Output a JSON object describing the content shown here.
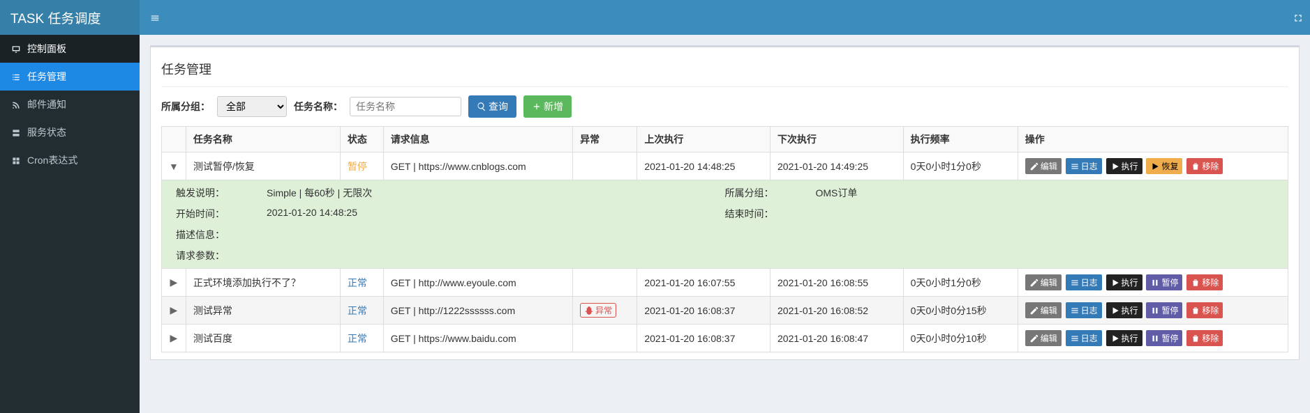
{
  "logo": "TASK 任务调度",
  "sidebar": {
    "header": "控制面板",
    "items": [
      {
        "label": "任务管理"
      },
      {
        "label": "邮件通知"
      },
      {
        "label": "服务状态"
      },
      {
        "label": "Cron表达式"
      }
    ]
  },
  "page": {
    "title": "任务管理",
    "filter": {
      "group_label": "所属分组：",
      "group_value": "全部",
      "name_label": "任务名称：",
      "name_placeholder": "任务名称",
      "query_btn": "查询",
      "add_btn": "新增"
    }
  },
  "table": {
    "headers": {
      "name": "任务名称",
      "status": "状态",
      "request": "请求信息",
      "error": "异常",
      "last": "上次执行",
      "next": "下次执行",
      "freq": "执行频率",
      "action": "操作"
    },
    "rows": [
      {
        "expanded": true,
        "name": "测试暂停/恢复",
        "status": "暂停",
        "status_class": "status-pause",
        "request": "GET | https://www.cnblogs.com",
        "error": "",
        "last": "2021-01-20 14:48:25",
        "next": "2021-01-20 14:49:25",
        "freq": "0天0小时1分0秒",
        "resume": true,
        "detail": {
          "trigger_label": "触发说明：",
          "trigger": "Simple | 每60秒 | 无限次",
          "group_label": "所属分组：",
          "group": "OMS订单",
          "start_label": "开始时间：",
          "start": "2021-01-20 14:48:25",
          "end_label": "结束时间：",
          "end": "",
          "desc_label": "描述信息：",
          "desc": "",
          "param_label": "请求参数：",
          "param": ""
        }
      },
      {
        "expanded": false,
        "name": "正式环境添加执行不了？",
        "status": "正常",
        "status_class": "status-normal",
        "request": "GET | http://www.eyoule.com",
        "error": "",
        "last": "2021-01-20 16:07:55",
        "next": "2021-01-20 16:08:55",
        "freq": "0天0小时1分0秒",
        "resume": false
      },
      {
        "expanded": false,
        "name": "测试异常",
        "status": "正常",
        "status_class": "status-normal",
        "request": "GET | http://1222ssssss.com",
        "error": "异常",
        "last": "2021-01-20 16:08:37",
        "next": "2021-01-20 16:08:52",
        "freq": "0天0小时0分15秒",
        "resume": false
      },
      {
        "expanded": false,
        "name": "测试百度",
        "status": "正常",
        "status_class": "status-normal",
        "request": "GET | https://www.baidu.com",
        "error": "",
        "last": "2021-01-20 16:08:37",
        "next": "2021-01-20 16:08:47",
        "freq": "0天0小时0分10秒",
        "resume": false
      }
    ],
    "actions": {
      "edit": "编辑",
      "log": "日志",
      "exec": "执行",
      "resume": "恢复",
      "pause": "暂停",
      "delete": "移除"
    }
  }
}
